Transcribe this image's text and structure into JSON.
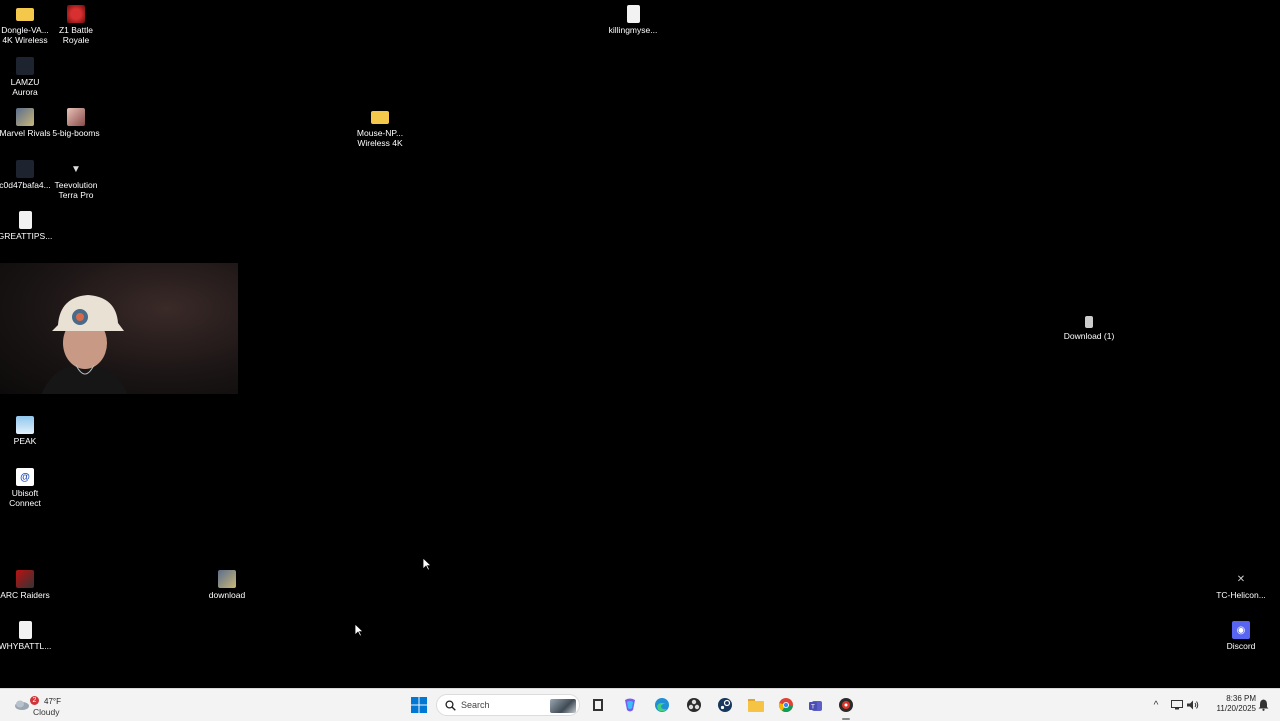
{
  "desktop_icons": [
    {
      "label": "Dongle-VA...\n4K Wireless",
      "icon": "folder-icon"
    },
    {
      "label": "Z1 Battle\nRoyale",
      "icon": "game-icon"
    },
    {
      "label": "LAMZU\nAurora",
      "icon": "app-icon"
    },
    {
      "label": "Marvel Rivals",
      "icon": "game-icon"
    },
    {
      "label": "5-big-booms",
      "icon": "image-icon"
    },
    {
      "label": "c0d47bafa4...",
      "icon": "file-icon"
    },
    {
      "label": "Teevolution\nTerra Pro",
      "icon": "app-icon"
    },
    {
      "label": "GREATTIPS...",
      "icon": "document-icon"
    },
    {
      "label": "Mouse-NP...\nWireless 4K",
      "icon": "folder-icon"
    },
    {
      "label": "killingmyse...",
      "icon": "document-icon"
    },
    {
      "label": "Download (1)",
      "icon": "image-icon"
    },
    {
      "label": "PEAK",
      "icon": "game-icon"
    },
    {
      "label": "Ubisoft\nConnect",
      "icon": "app-icon"
    },
    {
      "label": "ARC Raiders",
      "icon": "game-icon"
    },
    {
      "label": "download",
      "icon": "image-icon"
    },
    {
      "label": "WHYBATTL...",
      "icon": "document-icon"
    },
    {
      "label": "TC-Helicon...",
      "icon": "app-icon"
    },
    {
      "label": "Discord",
      "icon": "discord-icon"
    }
  ],
  "taskbar": {
    "weather": {
      "temperature": "47°F",
      "condition": "Cloudy",
      "badge": "2"
    },
    "search": {
      "placeholder": "Search"
    },
    "pinned": [
      "start-icon",
      "task-view-icon",
      "copilot-icon",
      "edge-icon",
      "obs-icon",
      "steam-icon",
      "file-explorer-icon",
      "chrome-icon",
      "teams-icon",
      "game-app-icon"
    ],
    "tray": {
      "time": "8:36 PM",
      "date": "11/20/2025"
    }
  },
  "colors": {
    "desktop_bg": "#000000",
    "taskbar_bg": "#f3f3f3",
    "start_blue": "#0078d4"
  }
}
